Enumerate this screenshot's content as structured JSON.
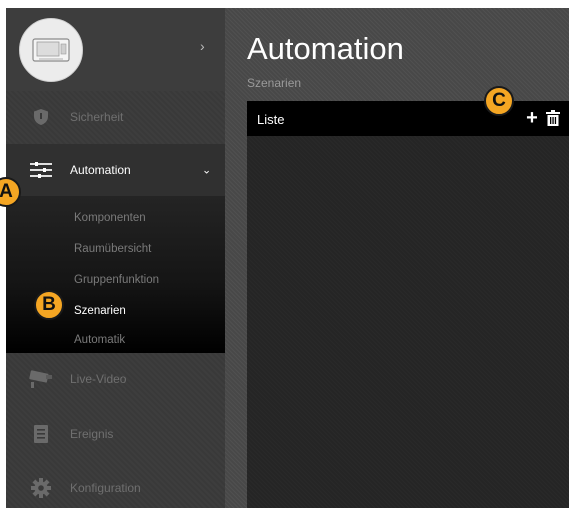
{
  "sidebar": {
    "items": [
      {
        "label": "Sicherheit",
        "icon": "shield-icon"
      },
      {
        "label": "Automation",
        "icon": "sliders-icon"
      },
      {
        "label": "Live-Video",
        "icon": "camera-icon"
      },
      {
        "label": "Ereignis",
        "icon": "event-list-icon"
      },
      {
        "label": "Konfiguration",
        "icon": "gear-icon"
      }
    ],
    "submenu": [
      {
        "label": "Komponenten"
      },
      {
        "label": "Raumübersicht"
      },
      {
        "label": "Gruppenfunktion"
      },
      {
        "label": "Szenarien"
      },
      {
        "label": "Automatik"
      }
    ]
  },
  "main": {
    "title": "Automation",
    "subtitle": "Szenarien",
    "list": {
      "title": "Liste",
      "add_label": "+"
    }
  },
  "markers": {
    "a": "A",
    "b": "B",
    "c": "C"
  },
  "colors": {
    "marker": "#f5a623",
    "sidebar": "#3a3a3a",
    "header_bar": "#000000"
  }
}
